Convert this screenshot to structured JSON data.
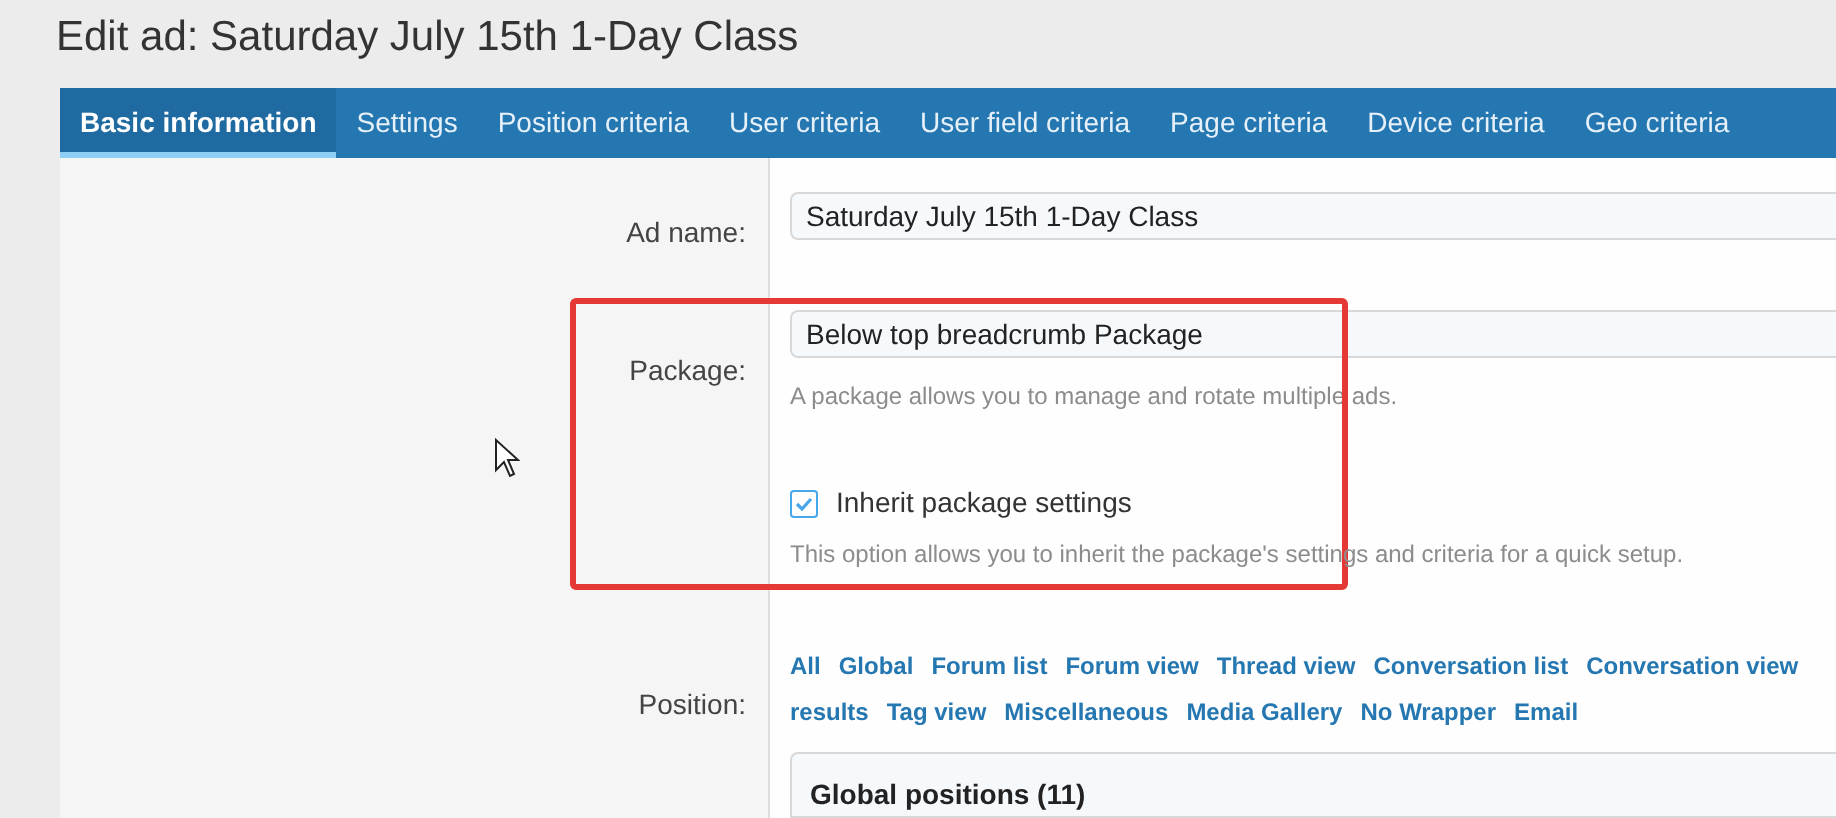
{
  "page_title": "Edit ad: Saturday July 15th 1-Day Class",
  "tabs": [
    {
      "label": "Basic information",
      "selected": true
    },
    {
      "label": "Settings",
      "selected": false
    },
    {
      "label": "Position criteria",
      "selected": false
    },
    {
      "label": "User criteria",
      "selected": false
    },
    {
      "label": "User field criteria",
      "selected": false
    },
    {
      "label": "Page criteria",
      "selected": false
    },
    {
      "label": "Device criteria",
      "selected": false
    },
    {
      "label": "Geo criteria",
      "selected": false
    }
  ],
  "ad_name": {
    "label": "Ad name:",
    "value": "Saturday July 15th 1-Day Class"
  },
  "package": {
    "label": "Package:",
    "value": "Below top breadcrumb Package",
    "hint": "A package allows you to manage and rotate multiple ads."
  },
  "inherit": {
    "label": "Inherit package settings",
    "checked": true,
    "hint": "This option allows you to inherit the package's settings and criteria for a quick setup."
  },
  "position": {
    "label": "Position:",
    "filters_line_1": [
      "All",
      "Global",
      "Forum list",
      "Forum view",
      "Thread view",
      "Conversation list",
      "Conversation view"
    ],
    "filters_line_2": [
      "results",
      "Tag view",
      "Miscellaneous",
      "Media Gallery",
      "No Wrapper",
      "Email"
    ],
    "group_title": "Global positions (11)"
  }
}
